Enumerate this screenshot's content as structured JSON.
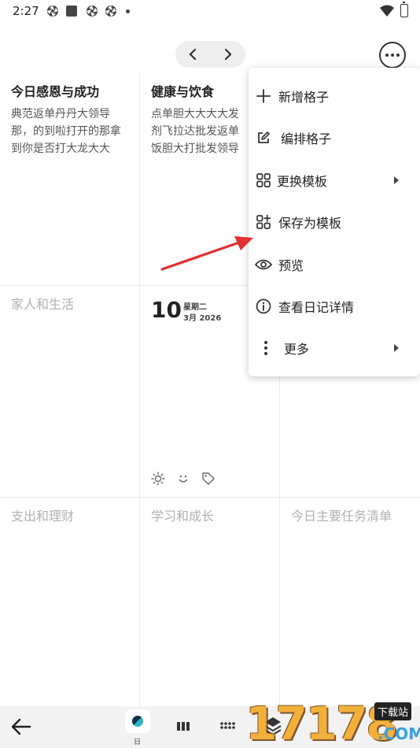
{
  "status_bar": {
    "time": "2:27"
  },
  "cells": [
    {
      "title": "今日感恩与成功",
      "body": "典范返单丹丹大领导那，的到啦打开的那拿到你是否打大龙大大"
    },
    {
      "title": "健康与饮食",
      "body": "点单胆大大大大发剂飞拉达批发返单饭胆大打批发领导"
    },
    {
      "title": "家人和生活"
    },
    {
      "title": "支出和理财"
    },
    {
      "title": "学习和成长"
    },
    {
      "title": "今日主要任务清单"
    }
  ],
  "date_cell": {
    "day": "10",
    "weekday": "星期二",
    "month_year": "3月 2026"
  },
  "menu": {
    "items": [
      {
        "label": "新增格子",
        "icon": "plus-icon"
      },
      {
        "label": "编排格子",
        "icon": "edit-icon"
      },
      {
        "label": "更换模板",
        "icon": "grid-icon",
        "submenu": true
      },
      {
        "label": "保存为模板",
        "icon": "grid-add-icon"
      },
      {
        "label": "预览",
        "icon": "eye-icon"
      },
      {
        "label": "查看日记详情",
        "icon": "info-icon"
      },
      {
        "label": "更多",
        "icon": "more-vert-icon",
        "submenu": true
      }
    ]
  },
  "bottom_bar": {
    "day_label": "日"
  },
  "watermark": {
    "number": "17178",
    "tag": "下载站",
    "domain": ".COM"
  },
  "colors": {
    "accent_arrow": "#e03030",
    "watermark": "#f2a51c",
    "menu_bg": "#ffffff",
    "bottom_bar_bg": "#f2f2f2"
  }
}
